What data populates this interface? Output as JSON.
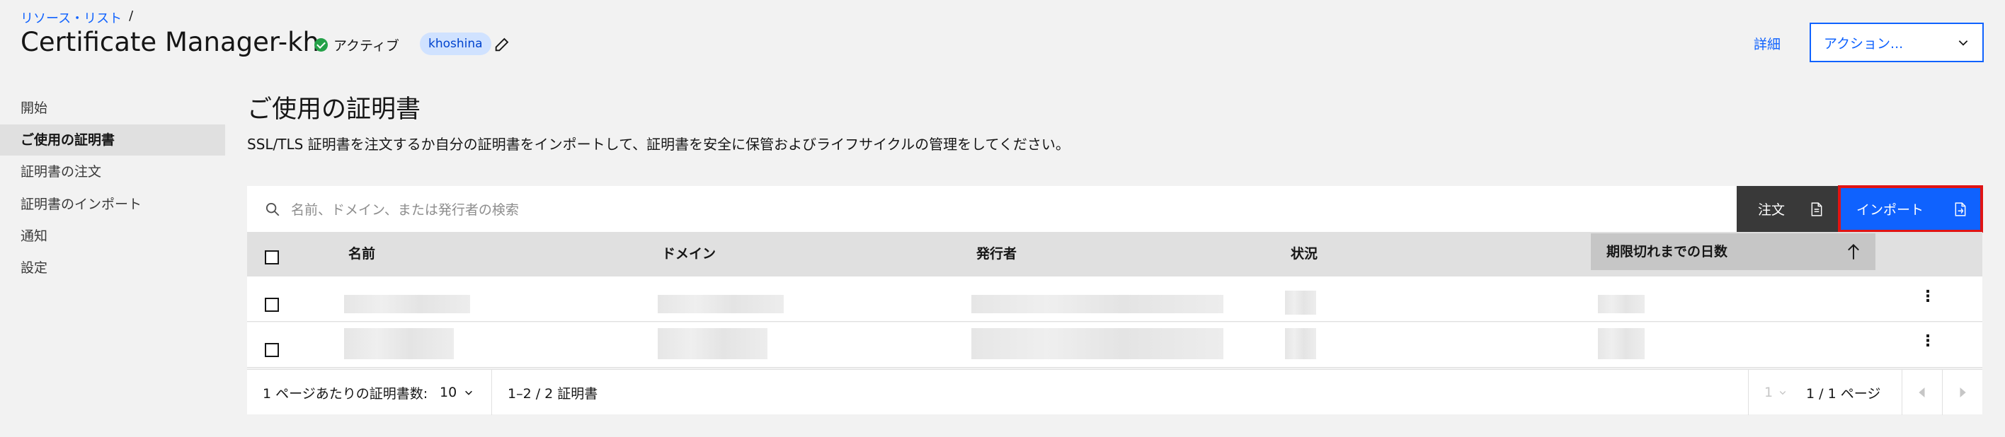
{
  "breadcrumb": {
    "link": "リソース・リスト",
    "separator": "/"
  },
  "header": {
    "title": "Certificate Manager-kh",
    "status": "アクティブ",
    "status_color": "#24a148",
    "tag": "khoshina",
    "details_link": "詳細",
    "actions_label": "アクション..."
  },
  "sidebar": {
    "items": [
      {
        "label": "開始",
        "active": false
      },
      {
        "label": "ご使用の証明書",
        "active": true
      },
      {
        "label": "証明書の注文",
        "active": false
      },
      {
        "label": "証明書のインポート",
        "active": false
      },
      {
        "label": "通知",
        "active": false
      },
      {
        "label": "設定",
        "active": false
      }
    ]
  },
  "main": {
    "title": "ご使用の証明書",
    "description": "SSL/TLS 証明書を注文するか自分の証明書をインポートして、証明書を安全に保管およびライフサイクルの管理をしてください。"
  },
  "toolbar": {
    "search_placeholder": "名前、ドメイン、または発行者の検索",
    "order_label": "注文",
    "import_label": "インポート",
    "primary_color": "#0f62fe"
  },
  "table": {
    "columns": [
      "名前",
      "ドメイン",
      "発行者",
      "状況",
      "期限切れまでの日数"
    ],
    "sorted_column": "期限切れまでの日数",
    "sort_direction": "ascending",
    "rows_redacted": 2
  },
  "pagination": {
    "per_page_label": "1 ページあたりの証明書数:",
    "per_page_value": "10",
    "range_label": "1–2 / 2 証明書",
    "page_select": "1",
    "page_label": "1 / 1 ページ"
  }
}
